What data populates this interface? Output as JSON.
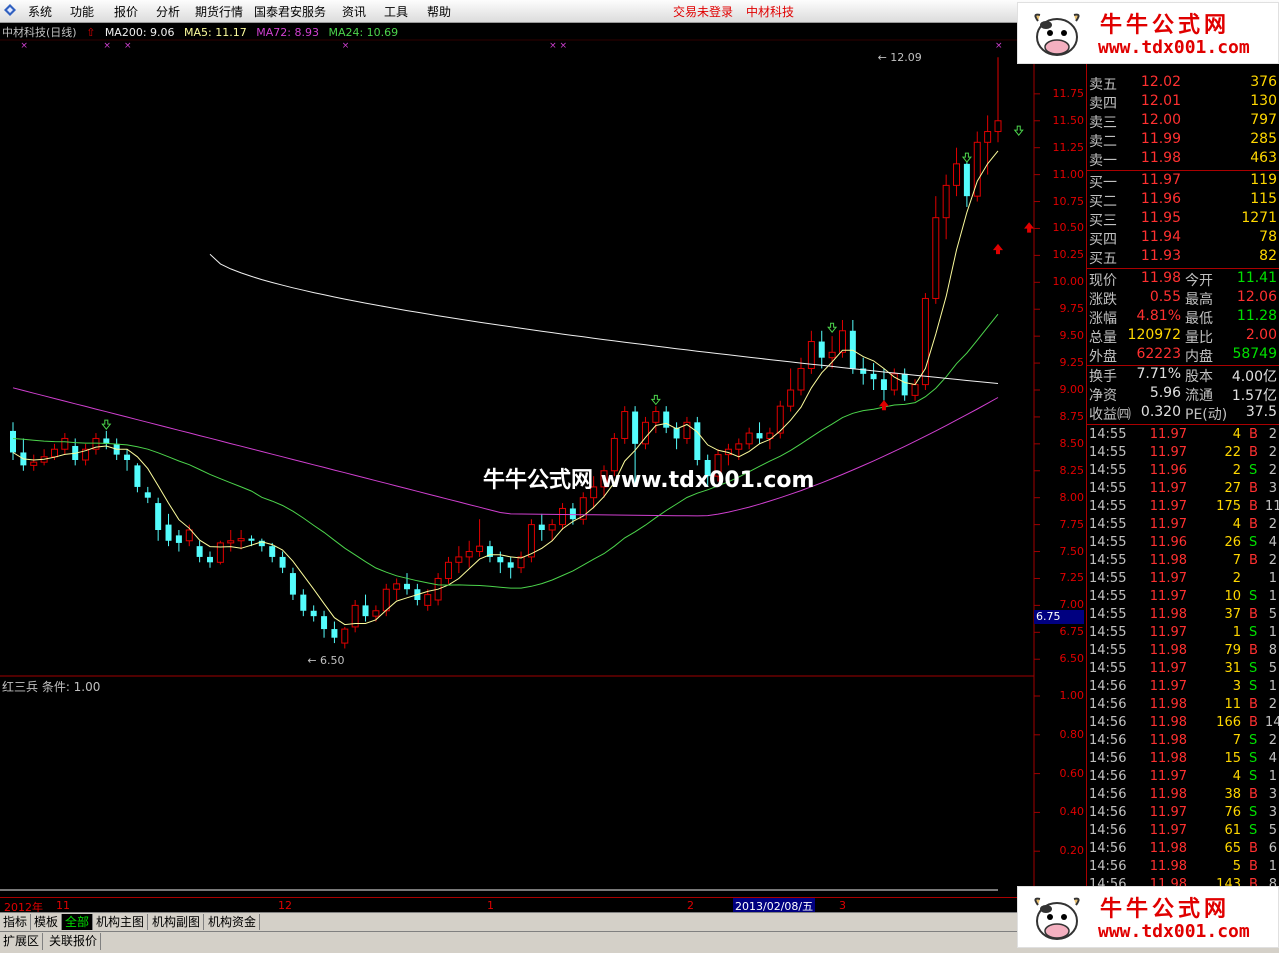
{
  "menu": {
    "items": [
      "系统",
      "功能",
      "报价",
      "分析",
      "期货行情",
      "国泰君安服务",
      "资讯",
      "工具",
      "帮助"
    ],
    "status_login": "交易未登录",
    "status_stock": "中材科技"
  },
  "title_line": {
    "stock": "中材科技(日线)",
    "ma200": "MA200: 9.06",
    "ma5": "MA5: 11.17",
    "ma72": "MA72: 8.93",
    "ma24": "MA24: 10.69"
  },
  "colors": {
    "up": "#e00000",
    "down": "#54fcfc",
    "ma5": "#fcfc9c",
    "ma24": "#4cd44c",
    "ma72": "#d040d0",
    "ma200": "#f0f0f0"
  },
  "price_axis": [
    "11.75",
    "11.50",
    "11.25",
    "11.00",
    "10.75",
    "10.50",
    "10.25",
    "10.00",
    "9.75",
    "9.50",
    "9.25",
    "9.00",
    "8.75",
    "8.50",
    "8.25",
    "8.00",
    "7.75",
    "7.50",
    "7.25",
    "7.00",
    "6.75",
    "6.50"
  ],
  "cursor_price": "6.75",
  "indicator": {
    "label": "红三兵  条件: 1.00",
    "axis": [
      "1.00",
      "0.80",
      "0.60",
      "0.40",
      "0.20"
    ],
    "signal_on_from_index": 97
  },
  "annotations": {
    "high": "12.09",
    "low": "6.50"
  },
  "date_axis": {
    "labels": [
      "2012年",
      "11",
      "12",
      "1",
      "2",
      "3"
    ],
    "cursor": "2013/02/08/五"
  },
  "tabs": [
    "指标",
    "模板",
    "全部",
    "机构主图",
    "机构副图",
    "机构资金"
  ],
  "active_tab": "全部",
  "bottom_tabs": [
    "扩展区",
    "关联报价"
  ],
  "quotes": {
    "sell": [
      {
        "label": "卖五",
        "price": "12.02",
        "vol": "376"
      },
      {
        "label": "卖四",
        "price": "12.01",
        "vol": "130"
      },
      {
        "label": "卖三",
        "price": "12.00",
        "vol": "797"
      },
      {
        "label": "卖二",
        "price": "11.99",
        "vol": "285"
      },
      {
        "label": "卖一",
        "price": "11.98",
        "vol": "463"
      }
    ],
    "buy": [
      {
        "label": "买一",
        "price": "11.97",
        "vol": "119"
      },
      {
        "label": "买二",
        "price": "11.96",
        "vol": "115"
      },
      {
        "label": "买三",
        "price": "11.95",
        "vol": "1271"
      },
      {
        "label": "买四",
        "price": "11.94",
        "vol": "78"
      },
      {
        "label": "买五",
        "price": "11.93",
        "vol": "82"
      }
    ],
    "stats": [
      {
        "l1": "现价",
        "v1": "11.98",
        "c1": "up",
        "l2": "今开",
        "v2": "11.41",
        "c2": "green"
      },
      {
        "l1": "涨跌",
        "v1": "0.55",
        "c1": "up",
        "l2": "最高",
        "v2": "12.06",
        "c2": "up"
      },
      {
        "l1": "涨幅",
        "v1": "4.81%",
        "c1": "up",
        "l2": "最低",
        "v2": "11.28",
        "c2": "green"
      },
      {
        "l1": "总量",
        "v1": "120972",
        "c1": "yellow",
        "l2": "量比",
        "v2": "2.00",
        "c2": "up"
      },
      {
        "l1": "外盘",
        "v1": "62223",
        "c1": "up",
        "l2": "内盘",
        "v2": "58749",
        "c2": "green"
      },
      {
        "l1": "换手",
        "v1": "7.71%",
        "c1": "white",
        "l2": "股本",
        "v2": "4.00亿",
        "c2": "white"
      },
      {
        "l1": "净资",
        "v1": "5.96",
        "c1": "white",
        "l2": "流通",
        "v2": "1.57亿",
        "c2": "white"
      },
      {
        "l1": "收益㈣",
        "v1": "0.320",
        "c1": "white",
        "l2": "PE(动)",
        "v2": "37.5",
        "c2": "white"
      }
    ],
    "ticks": [
      {
        "t": "14:55",
        "p": "11.97",
        "v": "4",
        "bs": "B",
        "n": "2"
      },
      {
        "t": "14:55",
        "p": "11.97",
        "v": "22",
        "bs": "B",
        "n": "2"
      },
      {
        "t": "14:55",
        "p": "11.96",
        "v": "2",
        "bs": "S",
        "n": "2"
      },
      {
        "t": "14:55",
        "p": "11.97",
        "v": "27",
        "bs": "B",
        "n": "3"
      },
      {
        "t": "14:55",
        "p": "11.97",
        "v": "175",
        "bs": "B",
        "n": "11"
      },
      {
        "t": "14:55",
        "p": "11.97",
        "v": "4",
        "bs": "B",
        "n": "2"
      },
      {
        "t": "14:55",
        "p": "11.96",
        "v": "26",
        "bs": "S",
        "n": "4"
      },
      {
        "t": "14:55",
        "p": "11.98",
        "v": "7",
        "bs": "B",
        "n": "2"
      },
      {
        "t": "14:55",
        "p": "11.97",
        "v": "2",
        "bs": "",
        "n": "1"
      },
      {
        "t": "14:55",
        "p": "11.97",
        "v": "10",
        "bs": "S",
        "n": "1"
      },
      {
        "t": "14:55",
        "p": "11.98",
        "v": "37",
        "bs": "B",
        "n": "5"
      },
      {
        "t": "14:55",
        "p": "11.97",
        "v": "1",
        "bs": "S",
        "n": "1"
      },
      {
        "t": "14:55",
        "p": "11.98",
        "v": "79",
        "bs": "B",
        "n": "8"
      },
      {
        "t": "14:55",
        "p": "11.97",
        "v": "31",
        "bs": "S",
        "n": "5"
      },
      {
        "t": "14:56",
        "p": "11.97",
        "v": "3",
        "bs": "S",
        "n": "1"
      },
      {
        "t": "14:56",
        "p": "11.98",
        "v": "11",
        "bs": "B",
        "n": "2"
      },
      {
        "t": "14:56",
        "p": "11.98",
        "v": "166",
        "bs": "B",
        "n": "14"
      },
      {
        "t": "14:56",
        "p": "11.98",
        "v": "7",
        "bs": "S",
        "n": "2"
      },
      {
        "t": "14:56",
        "p": "11.98",
        "v": "15",
        "bs": "S",
        "n": "4"
      },
      {
        "t": "14:56",
        "p": "11.97",
        "v": "4",
        "bs": "S",
        "n": "1"
      },
      {
        "t": "14:56",
        "p": "11.98",
        "v": "38",
        "bs": "B",
        "n": "3"
      },
      {
        "t": "14:56",
        "p": "11.97",
        "v": "76",
        "bs": "S",
        "n": "3"
      },
      {
        "t": "14:56",
        "p": "11.97",
        "v": "61",
        "bs": "S",
        "n": "5"
      },
      {
        "t": "14:56",
        "p": "11.98",
        "v": "65",
        "bs": "B",
        "n": "6"
      },
      {
        "t": "14:56",
        "p": "11.98",
        "v": "5",
        "bs": "B",
        "n": "1"
      },
      {
        "t": "14:56",
        "p": "11.98",
        "v": "143",
        "bs": "B",
        "n": "8"
      }
    ]
  },
  "watermark": "牛牛公式网 www.tdx001.com",
  "logo": {
    "title": "牛牛公式网",
    "url": "www.tdx001.com"
  },
  "chart_data": {
    "type": "candlestick",
    "y_range": [
      6.4,
      12.25
    ],
    "candles": [
      [
        8.62,
        8.7,
        8.35,
        8.42
      ],
      [
        8.42,
        8.55,
        8.25,
        8.3
      ],
      [
        8.3,
        8.4,
        8.25,
        8.33
      ],
      [
        8.33,
        8.45,
        8.3,
        8.38
      ],
      [
        8.38,
        8.5,
        8.35,
        8.45
      ],
      [
        8.45,
        8.6,
        8.4,
        8.55
      ],
      [
        8.48,
        8.55,
        8.3,
        8.35
      ],
      [
        8.35,
        8.5,
        8.3,
        8.45
      ],
      [
        8.45,
        8.6,
        8.4,
        8.55
      ],
      [
        8.55,
        8.62,
        8.45,
        8.5
      ],
      [
        8.5,
        8.55,
        8.35,
        8.4
      ],
      [
        8.4,
        8.45,
        8.25,
        8.35
      ],
      [
        8.3,
        8.32,
        8.05,
        8.1
      ],
      [
        8.05,
        8.1,
        7.95,
        8.0
      ],
      [
        7.95,
        8.0,
        7.6,
        7.7
      ],
      [
        7.75,
        7.85,
        7.55,
        7.6
      ],
      [
        7.65,
        7.7,
        7.5,
        7.58
      ],
      [
        7.6,
        7.75,
        7.55,
        7.7
      ],
      [
        7.55,
        7.6,
        7.4,
        7.45
      ],
      [
        7.45,
        7.5,
        7.35,
        7.4
      ],
      [
        7.4,
        7.6,
        7.38,
        7.58
      ],
      [
        7.58,
        7.7,
        7.5,
        7.6
      ],
      [
        7.6,
        7.7,
        7.52,
        7.62
      ],
      [
        7.62,
        7.65,
        7.55,
        7.6
      ],
      [
        7.6,
        7.62,
        7.5,
        7.55
      ],
      [
        7.55,
        7.58,
        7.4,
        7.45
      ],
      [
        7.45,
        7.5,
        7.3,
        7.35
      ],
      [
        7.3,
        7.35,
        7.05,
        7.1
      ],
      [
        7.1,
        7.15,
        6.9,
        6.95
      ],
      [
        6.95,
        7.0,
        6.85,
        6.9
      ],
      [
        6.9,
        6.95,
        6.7,
        6.78
      ],
      [
        6.78,
        6.85,
        6.65,
        6.7
      ],
      [
        6.65,
        6.8,
        6.6,
        6.78
      ],
      [
        6.8,
        7.05,
        6.75,
        7.0
      ],
      [
        7.0,
        7.1,
        6.85,
        6.9
      ],
      [
        6.9,
        7.0,
        6.85,
        6.95
      ],
      [
        6.95,
        7.2,
        6.9,
        7.15
      ],
      [
        7.15,
        7.25,
        7.05,
        7.2
      ],
      [
        7.2,
        7.3,
        7.1,
        7.15
      ],
      [
        7.15,
        7.2,
        7.0,
        7.05
      ],
      [
        7.0,
        7.15,
        6.95,
        7.1
      ],
      [
        7.05,
        7.3,
        7.0,
        7.25
      ],
      [
        7.25,
        7.45,
        7.2,
        7.4
      ],
      [
        7.4,
        7.55,
        7.3,
        7.45
      ],
      [
        7.45,
        7.6,
        7.35,
        7.5
      ],
      [
        7.5,
        7.8,
        7.45,
        7.55
      ],
      [
        7.55,
        7.6,
        7.4,
        7.45
      ],
      [
        7.45,
        7.5,
        7.3,
        7.4
      ],
      [
        7.4,
        7.45,
        7.25,
        7.35
      ],
      [
        7.35,
        7.5,
        7.3,
        7.45
      ],
      [
        7.45,
        7.8,
        7.4,
        7.75
      ],
      [
        7.75,
        7.85,
        7.6,
        7.7
      ],
      [
        7.7,
        7.8,
        7.6,
        7.75
      ],
      [
        7.75,
        7.95,
        7.7,
        7.9
      ],
      [
        7.9,
        7.95,
        7.75,
        7.8
      ],
      [
        7.8,
        8.05,
        7.75,
        8.0
      ],
      [
        8.0,
        8.2,
        7.9,
        8.1
      ],
      [
        8.1,
        8.3,
        8.0,
        8.25
      ],
      [
        8.25,
        8.6,
        8.2,
        8.55
      ],
      [
        8.55,
        8.85,
        8.5,
        8.8
      ],
      [
        8.8,
        8.85,
        8.1,
        8.5
      ],
      [
        8.5,
        8.75,
        8.45,
        8.7
      ],
      [
        8.7,
        8.85,
        8.6,
        8.8
      ],
      [
        8.8,
        8.85,
        8.6,
        8.65
      ],
      [
        8.65,
        8.7,
        8.45,
        8.55
      ],
      [
        8.55,
        8.75,
        8.5,
        8.7
      ],
      [
        8.7,
        8.75,
        8.3,
        8.35
      ],
      [
        8.35,
        8.4,
        8.1,
        8.2
      ],
      [
        8.2,
        8.45,
        8.15,
        8.4
      ],
      [
        8.4,
        8.5,
        8.3,
        8.45
      ],
      [
        8.45,
        8.55,
        8.35,
        8.5
      ],
      [
        8.5,
        8.65,
        8.45,
        8.6
      ],
      [
        8.6,
        8.7,
        8.5,
        8.55
      ],
      [
        8.55,
        8.65,
        8.45,
        8.6
      ],
      [
        8.6,
        8.9,
        8.55,
        8.85
      ],
      [
        8.85,
        9.2,
        8.8,
        9.0
      ],
      [
        9.0,
        9.3,
        8.95,
        9.2
      ],
      [
        9.2,
        9.55,
        9.15,
        9.45
      ],
      [
        9.45,
        9.55,
        9.2,
        9.3
      ],
      [
        9.3,
        9.5,
        9.2,
        9.35
      ],
      [
        9.35,
        9.65,
        9.3,
        9.55
      ],
      [
        9.55,
        9.65,
        9.15,
        9.2
      ],
      [
        9.2,
        9.3,
        9.05,
        9.15
      ],
      [
        9.15,
        9.25,
        9.0,
        9.1
      ],
      [
        9.1,
        9.2,
        8.9,
        9.0
      ],
      [
        9.0,
        9.2,
        8.95,
        9.15
      ],
      [
        9.15,
        9.2,
        8.9,
        8.95
      ],
      [
        8.95,
        9.1,
        8.9,
        9.05
      ],
      [
        9.05,
        9.9,
        9.0,
        9.85
      ],
      [
        9.85,
        10.8,
        9.8,
        10.6
      ],
      [
        10.6,
        11.0,
        10.4,
        10.9
      ],
      [
        10.9,
        11.25,
        10.8,
        11.1
      ],
      [
        11.1,
        11.2,
        10.7,
        10.8
      ],
      [
        10.8,
        11.4,
        10.75,
        11.3
      ],
      [
        11.3,
        11.55,
        11.0,
        11.4
      ],
      [
        11.4,
        12.09,
        11.3,
        11.5
      ]
    ],
    "ma5_last": 11.17,
    "ma24_last": 10.69,
    "ma72_last": 8.93,
    "ma200_last": 9.06
  }
}
